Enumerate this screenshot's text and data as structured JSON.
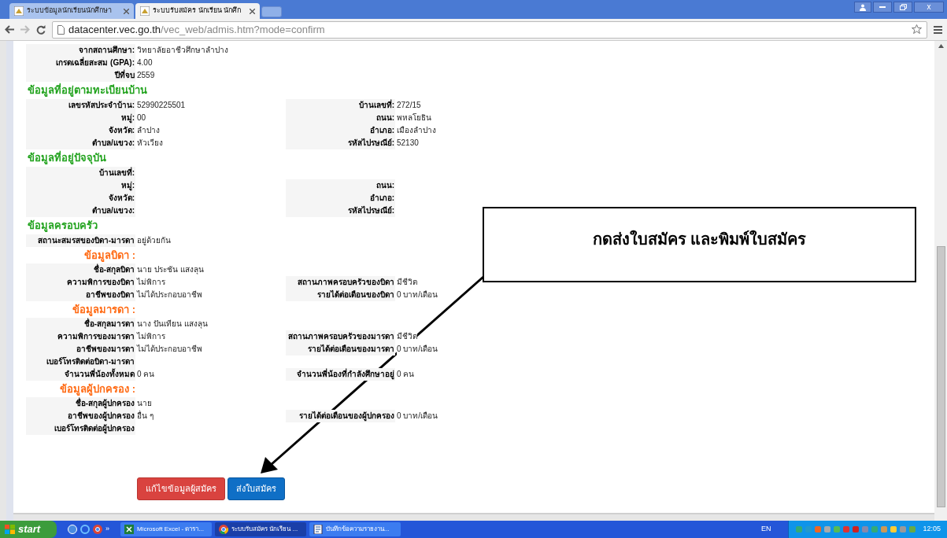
{
  "browser": {
    "tabs": [
      {
        "label": "ระบบข้อมูลนักเรียนนักศึกษา",
        "selected": false
      },
      {
        "label": "ระบบรับสมัคร นักเรียน นักศึก",
        "selected": true
      }
    ],
    "window_controls": [
      "x"
    ],
    "url_host": "datacenter.vec.go.th",
    "url_path": "/vec_web/admis.htm?mode=confirm"
  },
  "form": [
    {
      "kind": "row",
      "cells": [
        {
          "label": "จากสถานศึกษา:",
          "value": "วิทยาลัยอาชีวศึกษาลำปาง"
        }
      ]
    },
    {
      "kind": "row",
      "cells": [
        {
          "label": "เกรดเฉลี่ยสะสม (GPA):",
          "value": "4.00"
        }
      ]
    },
    {
      "kind": "row",
      "cells": [
        {
          "label": "ปีที่จบ",
          "value": "2559"
        }
      ]
    },
    {
      "kind": "heading",
      "text": "ข้อมูลที่อยู่ตามทะเบียนบ้าน"
    },
    {
      "kind": "row",
      "cells": [
        {
          "label": "เลขรหัสประจำบ้าน:",
          "value": "52990225501"
        },
        {
          "label": "บ้านเลขที่:",
          "value": "272/15"
        }
      ]
    },
    {
      "kind": "row",
      "cells": [
        {
          "label": "หมู่:",
          "value": "00"
        },
        {
          "label": "ถนน:",
          "value": "พหลโยธิน"
        }
      ]
    },
    {
      "kind": "row",
      "cells": [
        {
          "label": "จังหวัด:",
          "value": "ลำปาง"
        },
        {
          "label": "อำเภอ:",
          "value": "เมืองลำปาง"
        }
      ]
    },
    {
      "kind": "row",
      "cells": [
        {
          "label": "ตำบล/แขวง:",
          "value": "หัวเวียง"
        },
        {
          "label": "รหัสไปรษณีย์:",
          "value": "52130"
        }
      ]
    },
    {
      "kind": "heading",
      "text": "ข้อมูลที่อยู่ปัจจุบัน"
    },
    {
      "kind": "row",
      "cells": [
        {
          "label": "บ้านเลขที่:"
        }
      ]
    },
    {
      "kind": "row",
      "cells": [
        {
          "label": "หมู่:"
        },
        {
          "label": "ถนน:"
        }
      ]
    },
    {
      "kind": "row",
      "cells": [
        {
          "label": "จังหวัด:"
        },
        {
          "label": "อำเภอ:"
        }
      ]
    },
    {
      "kind": "row",
      "cells": [
        {
          "label": "ตำบล/แขวง:"
        },
        {
          "label": "รหัสไปรษณีย์:"
        }
      ]
    },
    {
      "kind": "heading",
      "text": "ข้อมูลครอบครัว"
    },
    {
      "kind": "row",
      "cells": [
        {
          "label": "สถานะสมรสของบิดา-มารดา",
          "value": "อยู่ด้วยกัน"
        }
      ]
    },
    {
      "kind": "subheading",
      "text": "ข้อมูลบิดา :"
    },
    {
      "kind": "row",
      "cells": [
        {
          "label": "ชื่อ-สกุลบิดา",
          "value": "นาย ประชัน แสงลุน"
        }
      ]
    },
    {
      "kind": "row",
      "cells": [
        {
          "label": "ความพิการของบิดา",
          "value": "ไม่พิการ"
        },
        {
          "label": "สถานภาพครอบครัวของบิดา",
          "value": "มีชีวิต"
        }
      ]
    },
    {
      "kind": "row",
      "cells": [
        {
          "label": "อาชีพของบิดา",
          "value": "ไม่ได้ประกอบอาชีพ"
        },
        {
          "label": "รายได้ต่อเดือนของบิดา",
          "value": "0 บาท/เดือน"
        }
      ]
    },
    {
      "kind": "subheading",
      "text": "ข้อมูลมารดา :"
    },
    {
      "kind": "row",
      "cells": [
        {
          "label": "ชื่อ-สกุลมารดา",
          "value": "นาง ปันเทียน แสงลุน"
        }
      ]
    },
    {
      "kind": "row",
      "cells": [
        {
          "label": "ความพิการของมารดา",
          "value": "ไม่พิการ"
        },
        {
          "label": "สถานภาพครอบครัวของมารดา",
          "value": "มีชีวิต"
        }
      ]
    },
    {
      "kind": "row",
      "cells": [
        {
          "label": "อาชีพของมารดา",
          "value": "ไม่ได้ประกอบอาชีพ"
        },
        {
          "label": "รายได้ต่อเดือนของมารดา",
          "value": "0 บาท/เดือน"
        }
      ]
    },
    {
      "kind": "row",
      "cells": [
        {
          "label": "เบอร์โทรติดต่อบิดา-มารดา"
        }
      ]
    },
    {
      "kind": "row",
      "cells": [
        {
          "label": "จำนวนพี่น้องทั้งหมด",
          "value": "0 คน"
        },
        {
          "label": "จำนวนพี่น้องที่กำลังศึกษาอยู่",
          "value": "0 คน"
        }
      ]
    },
    {
      "kind": "subheading",
      "text": "ข้อมูลผู้ปกครอง :"
    },
    {
      "kind": "row",
      "cells": [
        {
          "label": "ชื่อ-สกุลผู้ปกครอง",
          "value": "นาย"
        }
      ]
    },
    {
      "kind": "row",
      "cells": [
        {
          "label": "อาชีพของผู้ปกครอง",
          "value": "อื่น ๆ"
        },
        {
          "label": "รายได้ต่อเดือนของผู้ปกครอง",
          "value": "0 บาท/เดือน"
        }
      ]
    },
    {
      "kind": "row",
      "cells": [
        {
          "label": "เบอร์โทรติดต่อผู้ปกครอง"
        }
      ]
    }
  ],
  "buttons": [
    {
      "label": "แก้ไขข้อมูลผู้สมัคร",
      "kind": "danger"
    },
    {
      "label": "ส่งใบสมัคร",
      "kind": "primary"
    }
  ],
  "callout": {
    "text": "กดส่งใบสมัคร และพิมพ์ใบสมัคร"
  },
  "taskbar": {
    "start": "start",
    "more": "»",
    "tasks": [
      {
        "label": "Microsoft Excel - ดารา...",
        "kind": "excel",
        "selected": false
      },
      {
        "label": "ระบบรับสมัคร นักเรียน ...",
        "kind": "chrome",
        "selected": true
      },
      {
        "label": "บันทึกข้อความรายงาน...",
        "kind": "word",
        "selected": false
      }
    ],
    "language": "EN",
    "clock": "12:05"
  }
}
